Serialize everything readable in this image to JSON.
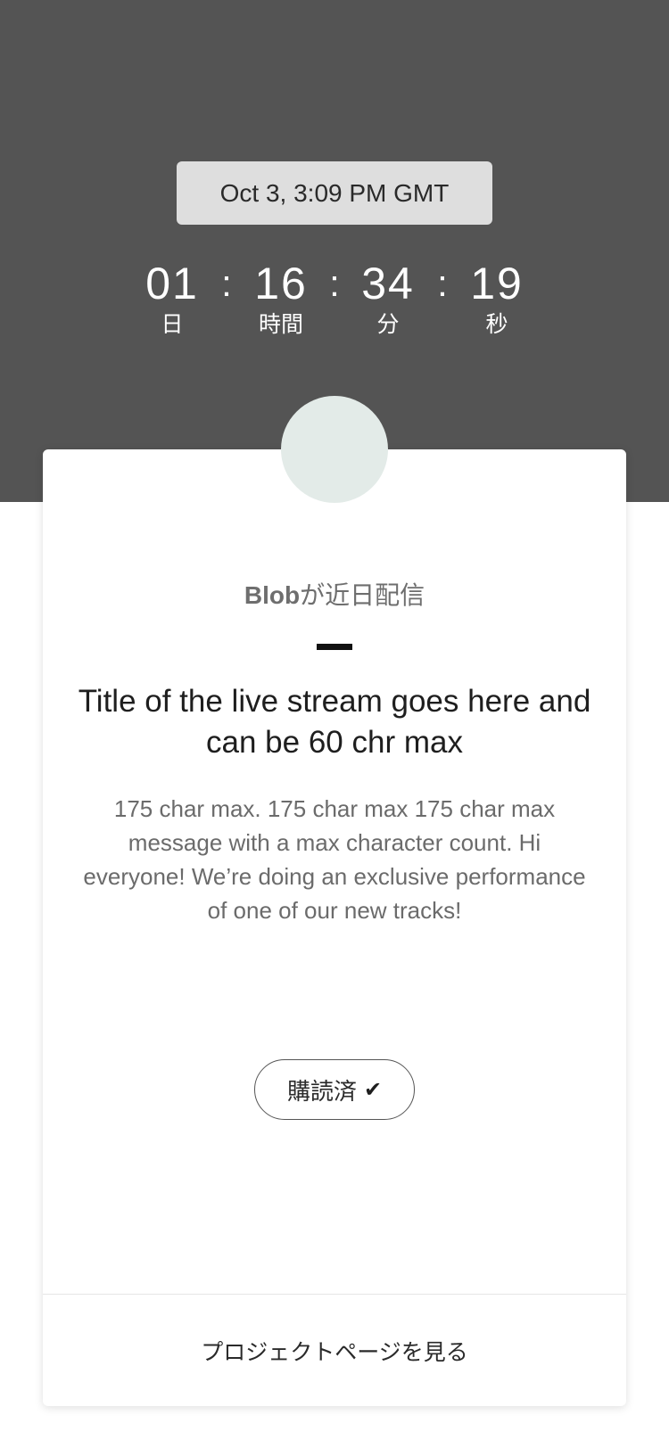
{
  "event": {
    "datetime": "Oct 3, 3:09 PM GMT"
  },
  "countdown": {
    "days": {
      "value": "01",
      "label": "日"
    },
    "hours": {
      "value": "16",
      "label": "時間"
    },
    "minutes": {
      "value": "34",
      "label": "分"
    },
    "seconds": {
      "value": "19",
      "label": "秒"
    },
    "separator": ":"
  },
  "card": {
    "artist": "Blob",
    "coming_soon_suffix": "が近日配信",
    "title": "Title of the live stream goes here and can be 60 chr max",
    "description": "175 char max. 175 char max 175 char max message with a max character count. Hi everyone! We’re doing an exclusive performance of one of our new tracks!",
    "subscribed_label": "購読済",
    "check_icon": "✔",
    "project_link_label": "プロジェクトページを見る"
  },
  "colors": {
    "header_bg": "#545454",
    "chip_bg": "#dedede",
    "avatar_bg": "#e3ebe8",
    "card_bg": "#ffffff"
  }
}
